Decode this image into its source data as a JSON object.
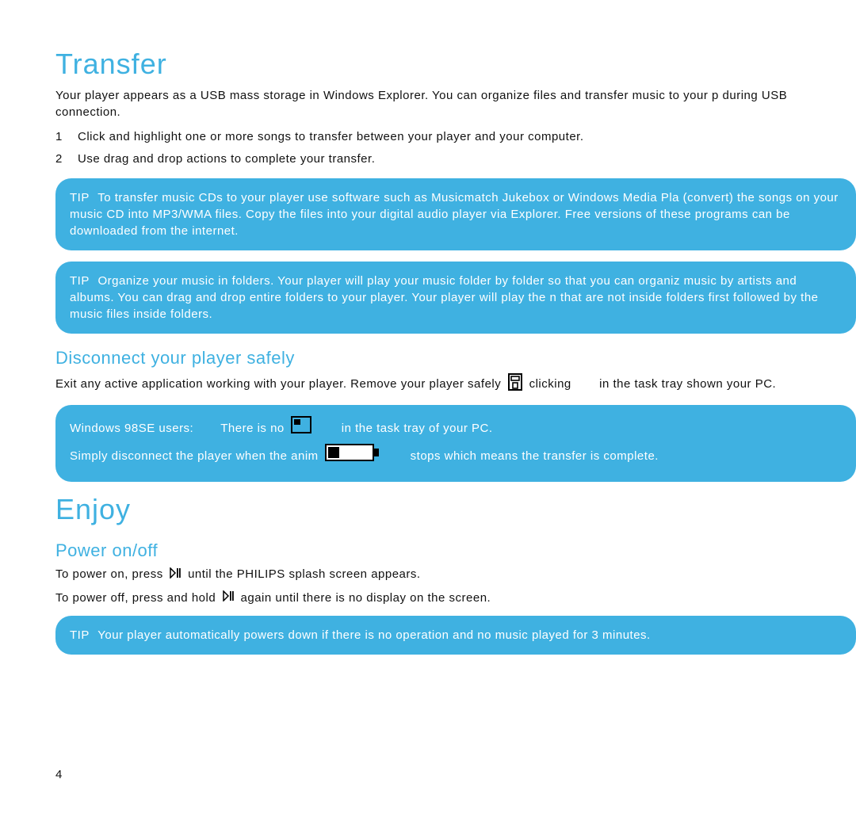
{
  "page_number": "4",
  "transfer": {
    "title": "Transfer",
    "intro": "Your player appears as a USB mass storage in Windows Explorer. You can organize files and transfer music to your p during USB connection.",
    "steps": [
      {
        "n": "1",
        "text": "Click and highlight one or more songs to transfer between your player and your computer."
      },
      {
        "n": "2",
        "text": "Use drag and drop actions to complete your transfer."
      }
    ],
    "tip1_label": "TIP",
    "tip1_text": "To transfer music CDs to your player use software such as Musicmatch Jukebox or Windows Media Pla (convert) the songs on your music CD into MP3/WMA files. Copy the files into your digital audio player via Explorer. Free versions of these programs can be downloaded from the internet.",
    "tip2_label": "TIP",
    "tip2_text": "Organize your music in folders. Your player will play your music folder by folder so that you can organiz music by artists and albums. You can drag and drop entire folders to your player. Your player will play the n that are not inside folders first followed by the music files inside folders."
  },
  "disconnect": {
    "title": "Disconnect your player safely",
    "line_pre": "Exit any active application working with your player. Remove your player safely",
    "line_mid": "clicking",
    "line_post": "in the task tray shown your PC.",
    "win98_label": "Windows 98SE users:",
    "win98_line1_pre": "There is no",
    "win98_line1_post": "in the task tray of your PC.",
    "win98_line2_pre": "Simply disconnect the player when the anim",
    "win98_line2_post": "stops which means the transfer is complete."
  },
  "enjoy": {
    "title": "Enjoy",
    "power_title": "Power on/off",
    "power_on_pre": "To power on, press",
    "power_on_post": "until the PHILIPS splash screen appears.",
    "power_off_pre": "To power off, press and hold",
    "power_off_post": "again until there is no display on the screen.",
    "tip_label": "TIP",
    "tip_text": "Your player automatically powers down if there is no operation and no music played for 3 minutes."
  }
}
